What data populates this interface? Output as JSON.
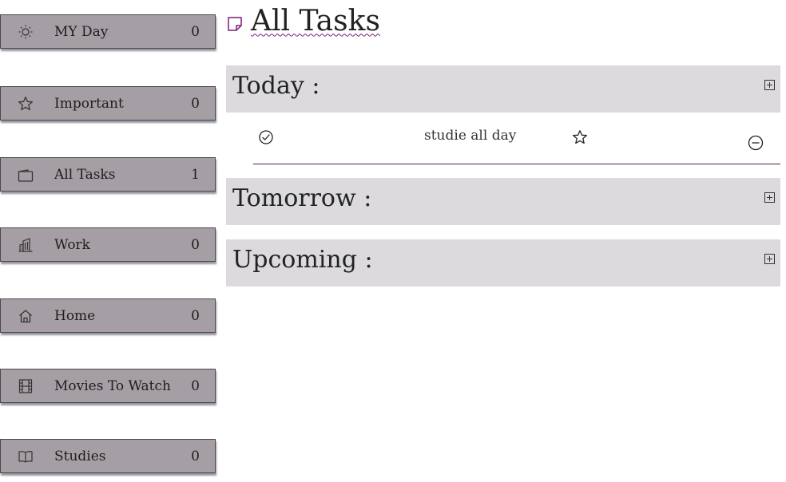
{
  "sidebar": {
    "items": [
      {
        "icon": "sun-icon",
        "label": "MY Day",
        "count": "0"
      },
      {
        "icon": "star-icon",
        "label": "Important",
        "count": "0"
      },
      {
        "icon": "folder-icon",
        "label": "All Tasks",
        "count": "1"
      },
      {
        "icon": "building-icon",
        "label": "Work",
        "count": "0"
      },
      {
        "icon": "home-icon",
        "label": "Home",
        "count": "0"
      },
      {
        "icon": "film-icon",
        "label": "Movies To Watch",
        "count": "0"
      },
      {
        "icon": "book-icon",
        "label": "Studies",
        "count": "0"
      }
    ]
  },
  "main": {
    "title_icon": "note-icon",
    "title": "All Tasks",
    "sections": [
      {
        "title": "Today :",
        "expand_icon": "plus-square-icon"
      },
      {
        "title": "Tomorrow :",
        "expand_icon": "plus-square-icon"
      },
      {
        "title": "Upcoming :",
        "expand_icon": "plus-square-icon"
      }
    ],
    "tasks": [
      {
        "text": "studie all day",
        "check_icon": "check-circle-icon",
        "star_icon": "star-outline-icon",
        "remove_icon": "minus-circle-icon"
      }
    ]
  },
  "colors": {
    "sidebar_bg": "#a59fa5",
    "section_bg": "#dcdadd",
    "accent": "#7a1f7a",
    "divider": "#4a1f4a"
  }
}
